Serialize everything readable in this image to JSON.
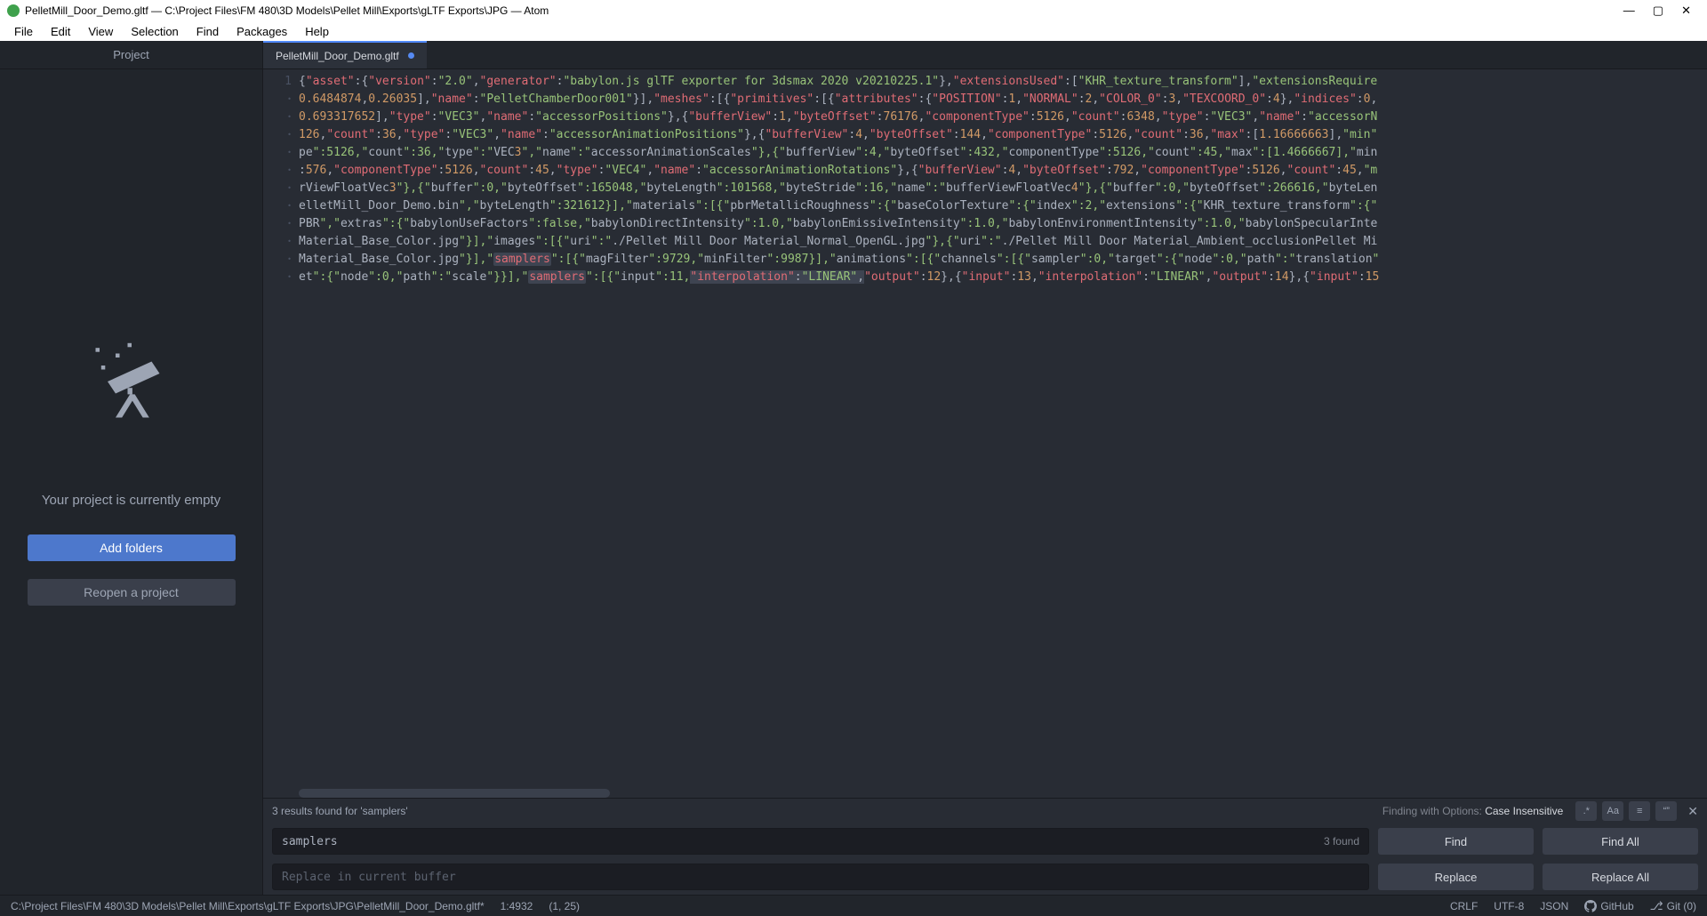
{
  "window": {
    "title": "PelletMill_Door_Demo.gltf — C:\\Project Files\\FM 480\\3D Models\\Pellet Mill\\Exports\\gLTF Exports\\JPG — Atom"
  },
  "menu": {
    "file": "File",
    "edit": "Edit",
    "view": "View",
    "selection": "Selection",
    "find": "Find",
    "packages": "Packages",
    "help": "Help"
  },
  "sidebar": {
    "tab": "Project",
    "empty_text": "Your project is currently empty",
    "add_folders": "Add folders",
    "reopen": "Reopen a project"
  },
  "tab": {
    "filename": "PelletMill_Door_Demo.gltf"
  },
  "gutter": {
    "line1": "1"
  },
  "code": {
    "l1_a": "{\"asset\":{\"version\":\"2.0\",\"generator\":\"babylon.js glTF exporter for 3dsmax 2020 v20210225.1\"},\"extensionsUsed\":[\"KHR_texture_transform\"],\"extensionsRequire",
    "l2_a": "0.6484874,0.26035],\"name\":\"PelletChamberDoor001\"}],\"meshes\":[{\"primitives\":[{\"attributes\":{\"POSITION\":1,\"NORMAL\":2,\"COLOR_0\":3,\"TEXCOORD_0\":4},\"indices\":0,",
    "l3_a": "0.693317652],\"type\":\"VEC3\",\"name\":\"accessorPositions\"},{\"bufferView\":1,\"byteOffset\":76176,\"componentType\":5126,\"count\":6348,\"type\":\"VEC3\",\"name\":\"accessorN",
    "l4_a": "126,\"count\":36,\"type\":\"VEC3\",\"name\":\"accessorAnimationPositions\"},{\"bufferView\":4,\"byteOffset\":144,\"componentType\":5126,\"count\":36,\"max\":[1.16666663],\"min\"",
    "l5_a": "pe\":5126,\"count\":36,\"type\":\"VEC3\",\"name\":\"accessorAnimationScales\"},{\"bufferView\":4,\"byteOffset\":432,\"componentType\":5126,\"count\":45,\"max\":[1.4666667],\"min",
    "l6_a": ":576,\"componentType\":5126,\"count\":45,\"type\":\"VEC4\",\"name\":\"accessorAnimationRotations\"},{\"bufferView\":4,\"byteOffset\":792,\"componentType\":5126,\"count\":45,\"m",
    "l7_a": "rViewFloatVec3\"},{\"buffer\":0,\"byteOffset\":165048,\"byteLength\":101568,\"byteStride\":16,\"name\":\"bufferViewFloatVec4\"},{\"buffer\":0,\"byteOffset\":266616,\"byteLen",
    "l8_a": "elletMill_Door_Demo.bin\",\"byteLength\":321612}],\"materials\":[{\"pbrMetallicRoughness\":{\"baseColorTexture\":{\"index\":2,\"extensions\":{\"KHR_texture_transform\":{\"",
    "l9_a": "PBR\",\"extras\":{\"babylonUseFactors\":false,\"babylonDirectIntensity\":1.0,\"babylonEmissiveIntensity\":1.0,\"babylonEnvironmentIntensity\":1.0,\"babylonSpecularInte",
    "l10_a": "Material_Base_Color.jpg\"}],\"images\":[{\"uri\":\"./Pellet Mill Door Material_Normal_OpenGL.jpg\"},{\"uri\":\"./Pellet Mill Door Material_Ambient_occlusionPellet Mi",
    "l11_a": "Material_Base_Color.jpg\"}],\"",
    "l11_hl": "samplers",
    "l11_b": "\":[{\"magFilter\":9729,\"minFilter\":9987}],\"animations\":[{\"channels\":[{\"sampler\":0,\"target\":{\"node\":0,\"path\":\"translation\"",
    "l12_a": "et\":{\"node\":0,\"path\":\"scale\"}}],\"",
    "l12_hl": "samplers",
    "l12_b": "\":[{\"input\":11,",
    "l12_sel": "\"interpolation\":\"LINEAR\",",
    "l12_c": "\"output\":12},{\"input\":13,\"interpolation\":\"LINEAR\",\"output\":14},{\"input\":15"
  },
  "find": {
    "results_text": "3 results found for 'samplers'",
    "opts_label": "Finding with Options: ",
    "opts_value": "Case Insensitive",
    "search_value": "samplers",
    "found_count": "3 found",
    "replace_placeholder": "Replace in current buffer",
    "btn_find": "Find",
    "btn_find_all": "Find All",
    "btn_replace": "Replace",
    "btn_replace_all": "Replace All",
    "opt_regex": ".*",
    "opt_case": "Aa",
    "opt_sel": "≡",
    "opt_word": "“”"
  },
  "status": {
    "path": "C:\\Project Files\\FM 480\\3D Models\\Pellet Mill\\Exports\\gLTF Exports\\JPG\\PelletMill_Door_Demo.gltf*",
    "position": "1:4932",
    "selection": "(1, 25)",
    "eol": "CRLF",
    "encoding": "UTF-8",
    "grammar": "JSON",
    "github": "GitHub",
    "git": "Git (0)"
  }
}
